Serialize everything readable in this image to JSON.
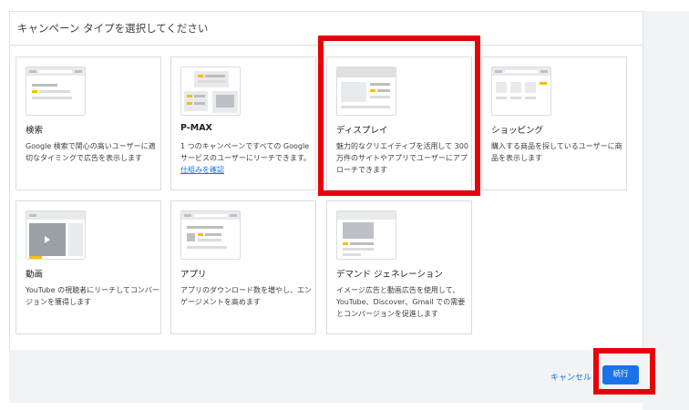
{
  "page": {
    "title": "キャンペーン タイプを選択してください"
  },
  "cards": [
    {
      "name": "検索",
      "desc": "Google 検索で関心の高いユーザーに適切なタイミングで広告を表示します"
    },
    {
      "name": "P-MAX",
      "desc": "1 つのキャンペーンですべての Google サービスのユーザーにリーチできます。",
      "link": "仕組みを確認"
    },
    {
      "name": "ディスプレイ",
      "desc": "魅力的なクリエイティブを活用して 300 万件のサイトやアプリでユーザーにアプローチできます"
    },
    {
      "name": "ショッピング",
      "desc": "購入する商品を探しているユーザーに商品を表示します"
    },
    {
      "name": "動画",
      "desc": "YouTube の視聴者にリーチしてコンバージョンを獲得します"
    },
    {
      "name": "アプリ",
      "desc": "アプリのダウンロード数を増やし、エンゲージメントを高めます"
    },
    {
      "name": "デマンド ジェネレーション",
      "desc": "イメージ広告と動画広告を使用して、YouTube、Discover、Gmail での需要とコンバージョンを促進します"
    }
  ],
  "footer": {
    "cancel_label": "キャンセル",
    "continue_label": "続行"
  },
  "colors": {
    "accent": "#1a73e8",
    "highlight": "#e8000b",
    "thumb_accent": "#fbbc04"
  }
}
